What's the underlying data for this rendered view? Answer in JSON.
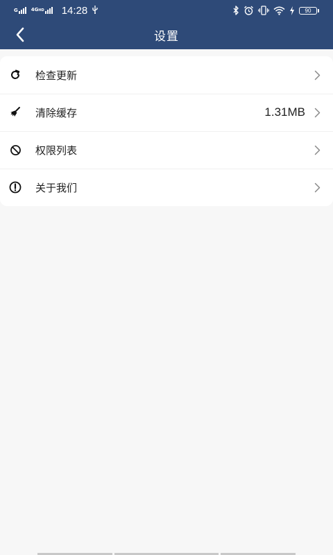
{
  "status_bar": {
    "network_label_1": "G",
    "network_label_2": "4G",
    "network_label_2_sup": "HD",
    "time": "14:28",
    "usb_icon": "usb-icon",
    "icons": [
      "bluetooth-icon",
      "alarm-icon",
      "vibrate-icon",
      "wifi-icon",
      "charging-icon"
    ],
    "battery": "90"
  },
  "navbar": {
    "title": "设置",
    "back_icon": "chevron-left-icon"
  },
  "settings": {
    "items": [
      {
        "icon": "refresh-icon",
        "label": "检查更新",
        "value": ""
      },
      {
        "icon": "broom-icon",
        "label": "清除缓存",
        "value": "1.31MB"
      },
      {
        "icon": "block-icon",
        "label": "权限列表",
        "value": ""
      },
      {
        "icon": "info-icon",
        "label": "关于我们",
        "value": ""
      }
    ]
  },
  "colors": {
    "header_bg": "#2e4a78",
    "page_bg": "#f7f7f7",
    "card_bg": "#ffffff",
    "text": "#222222",
    "chevron": "#8a8a8a"
  }
}
